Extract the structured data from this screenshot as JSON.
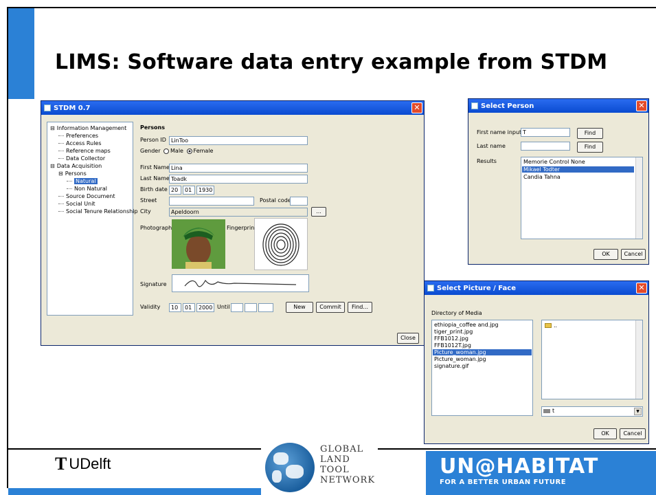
{
  "slide": {
    "title": "LIMS: Software data entry example from STDM",
    "accent_color": "#2b81d6"
  },
  "footer": {
    "tudelft_mark": "T",
    "tudelft_text": "UDelft",
    "gltn_lines": [
      "GLOBAL",
      "LAND",
      "TOOL",
      "NETWORK"
    ],
    "unhabitat_big": "UN@HABITAT",
    "unhabitat_small": "FOR A BETTER URBAN FUTURE"
  },
  "main_window": {
    "title": "STDM 0.7",
    "tree": [
      {
        "label": "Information Management",
        "level": 0,
        "expander": "⊟"
      },
      {
        "label": "Preferences",
        "level": 1
      },
      {
        "label": "Access Rules",
        "level": 1
      },
      {
        "label": "Reference maps",
        "level": 1
      },
      {
        "label": "Data Collector",
        "level": 1
      },
      {
        "label": "Data Acquisition",
        "level": 0,
        "expander": "⊟"
      },
      {
        "label": "Persons",
        "level": 1,
        "expander": "⊟"
      },
      {
        "label": "Natural",
        "level": 2,
        "selected": true
      },
      {
        "label": "Non Natural",
        "level": 2
      },
      {
        "label": "Source Document",
        "level": 1
      },
      {
        "label": "Social Unit",
        "level": 1
      },
      {
        "label": "Social Tenure Relationship",
        "level": 1
      }
    ],
    "section_title": "Persons",
    "person_id_label": "Person ID",
    "person_id_value": "LinToo",
    "gender_label": "Gender",
    "gender_male": "Male",
    "gender_female": "Female",
    "first_name_label": "First Name",
    "first_name_value": "Lina",
    "last_name_label": "Last Name",
    "last_name_value": "Toadk",
    "birth_date_label": "Birth date",
    "birth_day": "20",
    "birth_month": "01",
    "birth_year": "1930",
    "street_label": "Street",
    "postal_code_label": "Postal code",
    "city_label": "City",
    "city_value": "Apeldoorn",
    "browse_label": "...",
    "photograph_label": "Photograph",
    "fingerprint_label": "Fingerprint",
    "signature_label": "Signature",
    "validity_label": "Validity",
    "validity_day": "10",
    "validity_month": "01",
    "validity_year": "2000",
    "until_label": "Until",
    "new_label": "New",
    "commit_label": "Commit",
    "find_label": "Find...",
    "close_label": "Close"
  },
  "select_person": {
    "title": "Select Person",
    "first_name_label": "First name input",
    "first_name_value": "T",
    "last_name_label": "Last name",
    "find_label_1": "Find",
    "find_label_2": "Find",
    "results_label": "Results",
    "results": [
      "Memorie Control None",
      "Mikael Todter",
      "Candia Tahna"
    ],
    "selected_index": 1,
    "ok_label": "OK",
    "cancel_label": "Cancel"
  },
  "select_picture": {
    "title": "Select Picture / Face",
    "directory_label": "Directory of Media",
    "files": [
      "ethiopia_coffee and.jpg",
      "tiger_print.jpg",
      "FFB1012.jpg",
      "FFB1012T.jpg",
      "Picture_woman.jpg",
      "Picture_woman.jpg",
      "signature.gif"
    ],
    "selected_index": 4,
    "folder_item": "..",
    "drive_value": "t",
    "ok_label": "OK",
    "cancel_label": "Cancel"
  }
}
